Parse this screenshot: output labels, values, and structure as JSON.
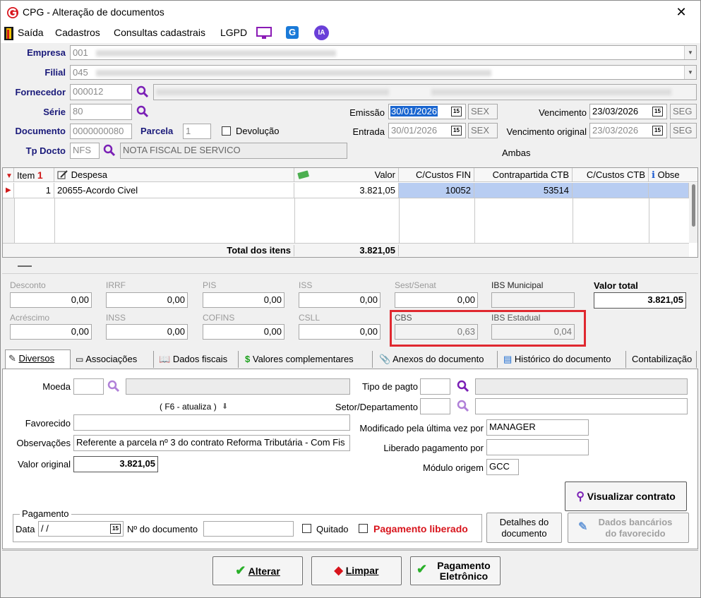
{
  "window": {
    "title": "CPG - Alteração de documentos",
    "close": "✕"
  },
  "menu": {
    "items": [
      "Saída",
      "Cadastros",
      "Consultas cadastrais",
      "LGPD"
    ],
    "ia_label": "IA",
    "g_label": "G"
  },
  "header": {
    "empresa": {
      "label": "Empresa",
      "value": "001"
    },
    "filial": {
      "label": "Filial",
      "value": "045"
    },
    "fornecedor": {
      "label": "Fornecedor",
      "value": "000012"
    },
    "serie": {
      "label": "Série",
      "value": "80"
    },
    "documento": {
      "label": "Documento",
      "value": "0000000080"
    },
    "parcela": {
      "label": "Parcela",
      "value": "1"
    },
    "devolucao": {
      "label": "Devolução",
      "checked": false
    },
    "tp_docto": {
      "label": "Tp Docto",
      "value": "NFS",
      "desc": "NOTA FISCAL DE SERVICO"
    },
    "emissao": {
      "label": "Emissão",
      "value": "30/01/2026",
      "weekday": "SEX"
    },
    "entrada": {
      "label": "Entrada",
      "value": "30/01/2026",
      "weekday": "SEX"
    },
    "vencimento": {
      "label": "Vencimento",
      "value": "23/03/2026",
      "weekday": "SEG"
    },
    "vencimento_original": {
      "label": "Vencimento original",
      "value": "23/03/2026",
      "weekday": "SEG"
    },
    "ambas": "Ambas",
    "cal_glyph": "15"
  },
  "grid": {
    "columns": [
      "Item",
      "Despesa",
      "Valor",
      "C/Custos FIN",
      "Contrapartida CTB",
      "C/Custos CTB",
      "Obse"
    ],
    "item_sort_glyph": "1",
    "info_glyph": "i",
    "rows": [
      {
        "item": "1",
        "despesa": "20655-Acordo Civel",
        "valor": "3.821,05",
        "cc_fin": "10052",
        "contrapartida": "53514",
        "cc_ctb": "",
        "obs": ""
      }
    ],
    "total_label": "Total dos itens",
    "total_value": "3.821,05"
  },
  "totals": {
    "desconto": {
      "label": "Desconto",
      "value": "0,00"
    },
    "irrf": {
      "label": "IRRF",
      "value": "0,00"
    },
    "pis": {
      "label": "PIS",
      "value": "0,00"
    },
    "iss": {
      "label": "ISS",
      "value": "0,00"
    },
    "sest": {
      "label": "Sest/Senat",
      "value": "0,00"
    },
    "ibs_municipal": {
      "label": "IBS Municipal"
    },
    "valor_total": {
      "label": "Valor total",
      "value": "3.821,05"
    },
    "acrescimo": {
      "label": "Acréscimo",
      "value": "0,00"
    },
    "inss": {
      "label": "INSS",
      "value": "0,00"
    },
    "cofins": {
      "label": "COFINS",
      "value": "0,00"
    },
    "csll": {
      "label": "CSLL",
      "value": "0,00"
    },
    "cbs": {
      "label": "CBS",
      "value": "0,63"
    },
    "ibs_estadual": {
      "label": "IBS Estadual",
      "value": "0,04"
    }
  },
  "tabs": [
    "Diversos",
    "Associações",
    "Dados fiscais",
    "Valores complementares",
    "Anexos do documento",
    "Histórico do documento",
    "Contabilização"
  ],
  "diversos": {
    "moeda": {
      "label": "Moeda",
      "value": ""
    },
    "f6": "( F6 - atualiza )",
    "favorecido": {
      "label": "Favorecido",
      "value": ""
    },
    "observacoes": {
      "label": "Observações",
      "value": "Referente a parcela nº 3 do contrato Reforma Tributária - Com Fis"
    },
    "valor_original": {
      "label": "Valor original",
      "value": "3.821,05"
    },
    "tipo_pagto": {
      "label": "Tipo de pagto",
      "value": ""
    },
    "setor": {
      "label": "Setor/Departamento",
      "value": ""
    },
    "modificado": {
      "label": "Modificado pela última vez por",
      "value": "MANAGER"
    },
    "liberado": {
      "label": "Liberado pagamento por",
      "value": ""
    },
    "modulo": {
      "label": "Módulo origem",
      "value": "GCC"
    },
    "visualizar": "Visualizar contrato",
    "pagamento": {
      "group": "Pagamento",
      "data_label": "Data",
      "data_value": "/ /",
      "ndoc_label": "Nº do documento",
      "ndoc_value": "",
      "quitado": "Quitado",
      "liberado": "Pagamento liberado"
    },
    "detalhes": [
      "Detalhes do",
      "documento"
    ],
    "dados_bancarios": [
      "Dados bancários",
      "do favorecido"
    ]
  },
  "footer": {
    "alterar": "Alterar",
    "limpar": "Limpar",
    "pagamento": [
      "Pagamento",
      "Eletrônico"
    ]
  },
  "colors": {
    "accent": "#1a1a7a",
    "highlight_red": "#e0282f",
    "selected_cell": "#b8cdf2",
    "liberado_red": "#d8141c",
    "icon_purple": "#7a1fb5"
  }
}
